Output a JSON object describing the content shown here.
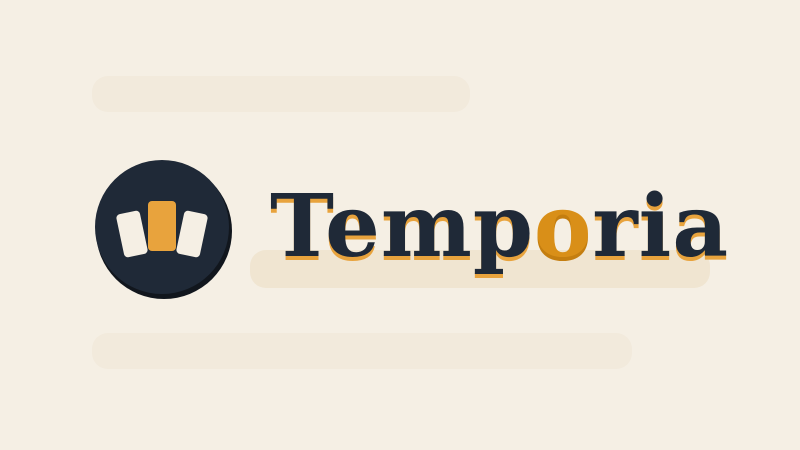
{
  "brand": {
    "name_before": "Temp",
    "name_accent": "o",
    "name_after": "ria",
    "icon": "cards-icon"
  },
  "colors": {
    "background": "#f5efe4",
    "ink": "#1f2937",
    "accent": "#e8a33d",
    "accent_dark": "#d98f18",
    "card_light": "#f5efe4"
  }
}
